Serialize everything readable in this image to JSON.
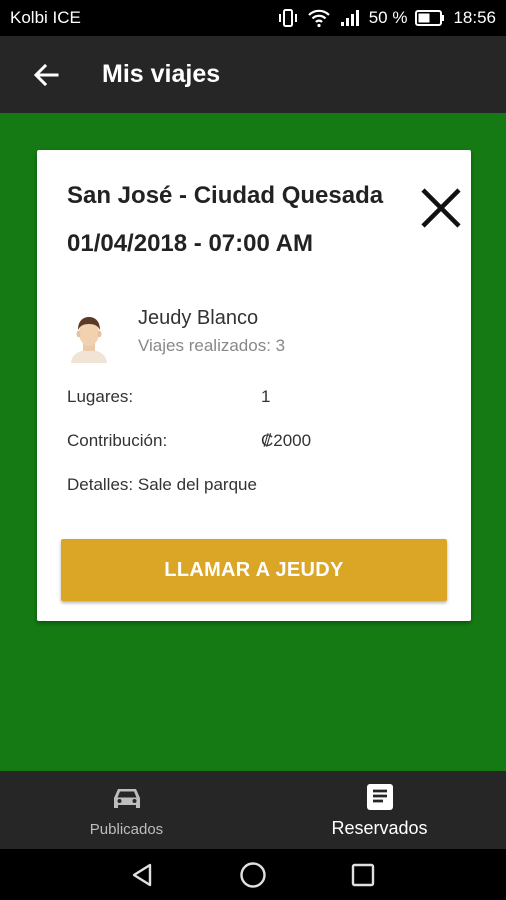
{
  "status_bar": {
    "carrier": "Kolbi ICE",
    "battery": "50 %",
    "time": "18:56",
    "icons": [
      "vibrate-icon",
      "wifi-icon",
      "signal-icon",
      "battery-icon"
    ]
  },
  "app_bar": {
    "title": "Mis viajes",
    "back_icon": "arrow-back-icon"
  },
  "colors": {
    "background": "#157a14",
    "app_bar": "#262626",
    "button": "#dba626",
    "card": "#ffffff"
  },
  "trip": {
    "route": "San José - Ciudad Quesada",
    "datetime": "01/04/2018 - 07:00 AM",
    "close_icon": "close-icon",
    "driver": {
      "name": "Jeudy Blanco",
      "trips": "Viajes realizados: 3",
      "avatar_icon": "avatar-icon"
    },
    "seats_label": "Lugares:",
    "seats_value": "1",
    "contribution_label": "Contribución:",
    "contribution_value": "₡2000",
    "details": "Detalles: Sale del parque",
    "call_button": "LLAMAR A JEUDY"
  },
  "bottom_nav": {
    "items": [
      {
        "label": "Publicados",
        "icon": "car-icon",
        "active": false
      },
      {
        "label": "Reservados",
        "icon": "receipt-icon",
        "active": true
      }
    ]
  },
  "system_nav": {
    "icons": [
      "back-triangle-icon",
      "home-circle-icon",
      "recents-square-icon"
    ]
  }
}
